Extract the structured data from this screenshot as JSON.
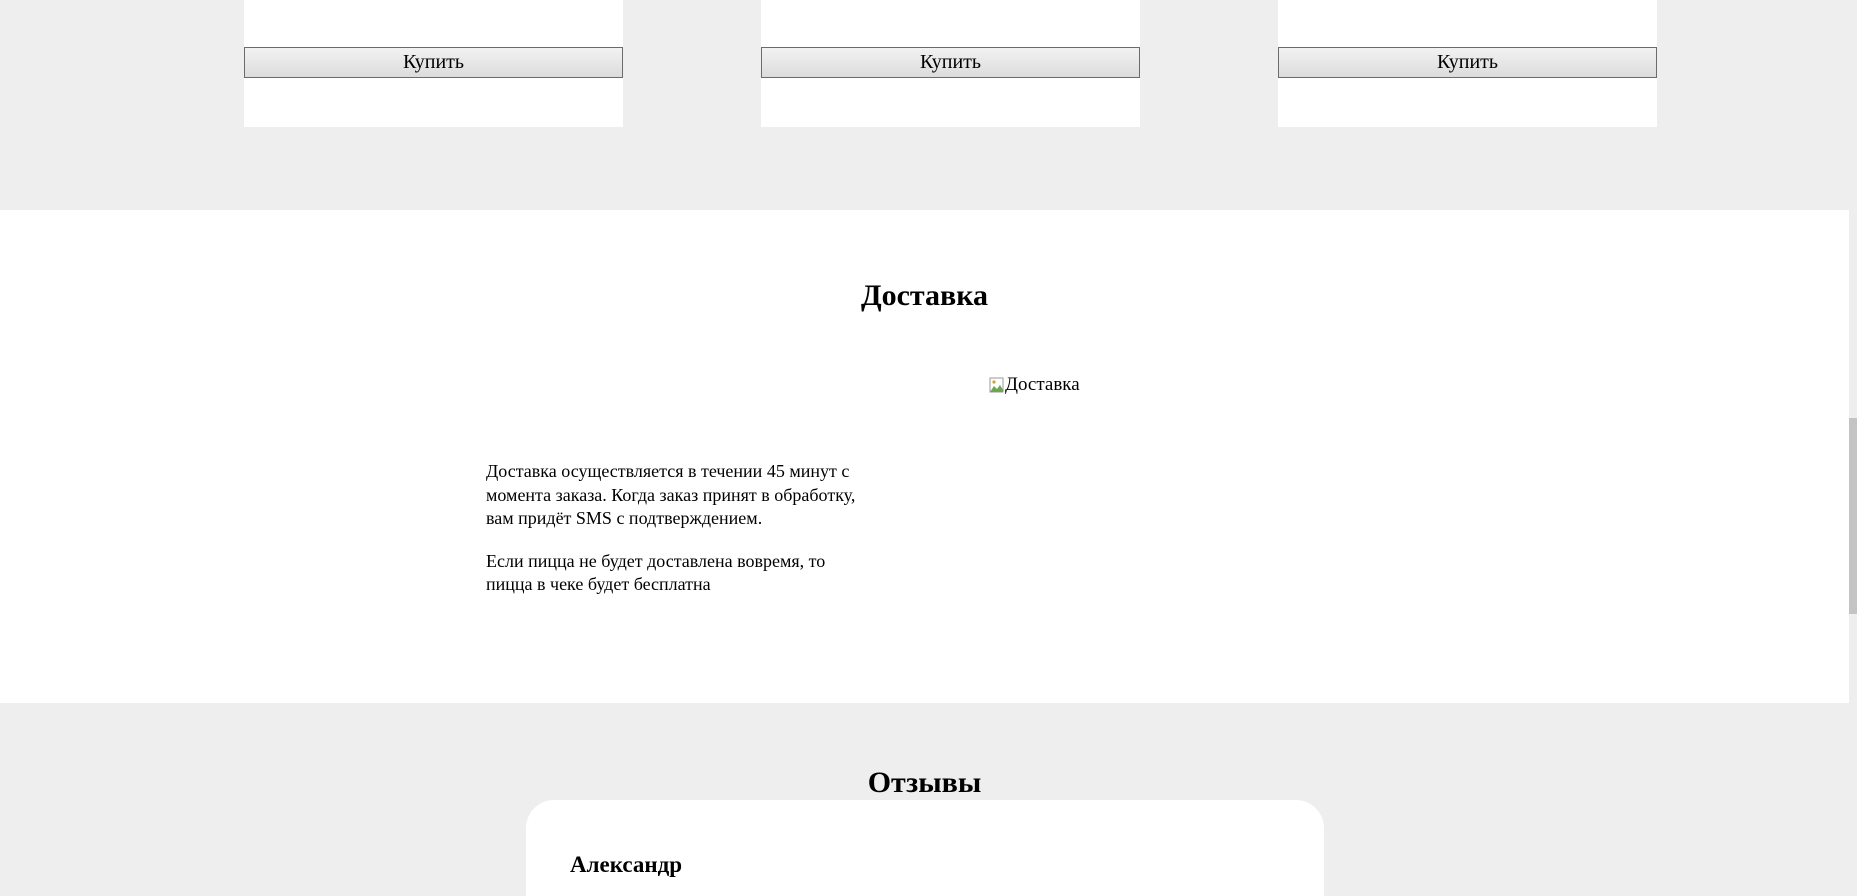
{
  "products": {
    "buy_buttons": [
      "Купить",
      "Купить",
      "Купить"
    ]
  },
  "delivery": {
    "title": "Доставка",
    "image_alt": "Доставка",
    "paragraphs": [
      "Доставка осуществляется в течении 45 минут с момента заказа. Когда заказ принят в обработку, вам придёт SMS с подтверждением.",
      "Если пицца не будет доставлена вовремя, то пицца в чеке будет бесплатна"
    ]
  },
  "reviews": {
    "title": "Отзывы",
    "items": [
      {
        "author": "Александр"
      }
    ]
  },
  "colors": {
    "page_bg": "#eeeeee",
    "section_bg": "#ffffff",
    "scrollbar_thumb": "#c4c4c4"
  },
  "icons": {
    "broken_image": "broken-image-icon"
  }
}
